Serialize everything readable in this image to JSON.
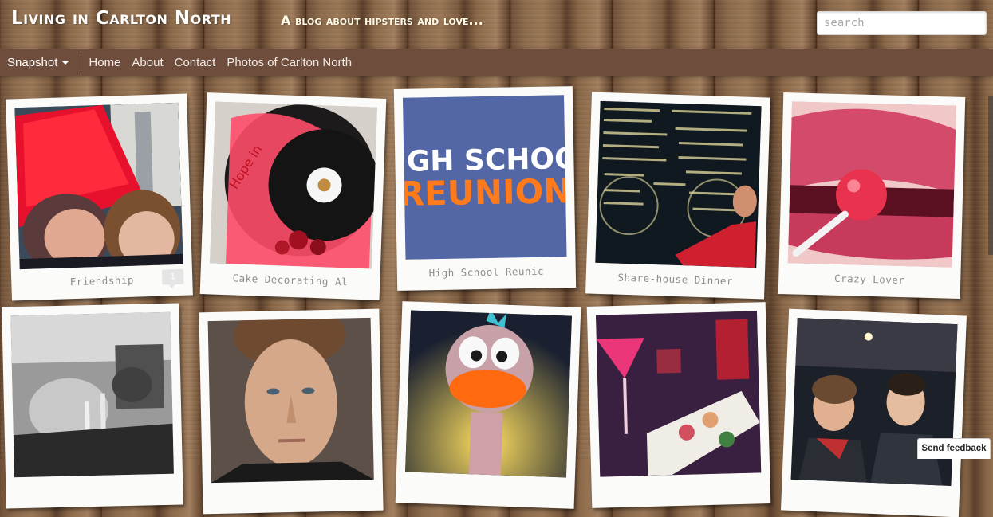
{
  "header": {
    "blog_title": "Living in Carlton North",
    "blog_description": "A blog about hipsters and love...",
    "search_placeholder": "search"
  },
  "navbar": {
    "view_label": "Snapshot",
    "links": [
      "Home",
      "About",
      "Contact",
      "Photos of Carlton North"
    ]
  },
  "posts": [
    {
      "caption": "Friendship",
      "comment_count": "1"
    },
    {
      "caption": "Cake Decorating Al"
    },
    {
      "caption": "High School Reunic"
    },
    {
      "caption": "Share-house Dinner"
    },
    {
      "caption": "Crazy Lover"
    },
    {
      "caption": ""
    },
    {
      "caption": ""
    },
    {
      "caption": ""
    },
    {
      "caption": ""
    },
    {
      "caption": ""
    }
  ],
  "reunion_graphic": {
    "line1": "HIGH SCHOOL",
    "line2": "REUNION"
  },
  "feedback_label": "Send feedback",
  "colors": {
    "navbar": "#6f4d3c",
    "reunion_blue": "#5367a6",
    "reunion_orange": "#e8701f"
  }
}
